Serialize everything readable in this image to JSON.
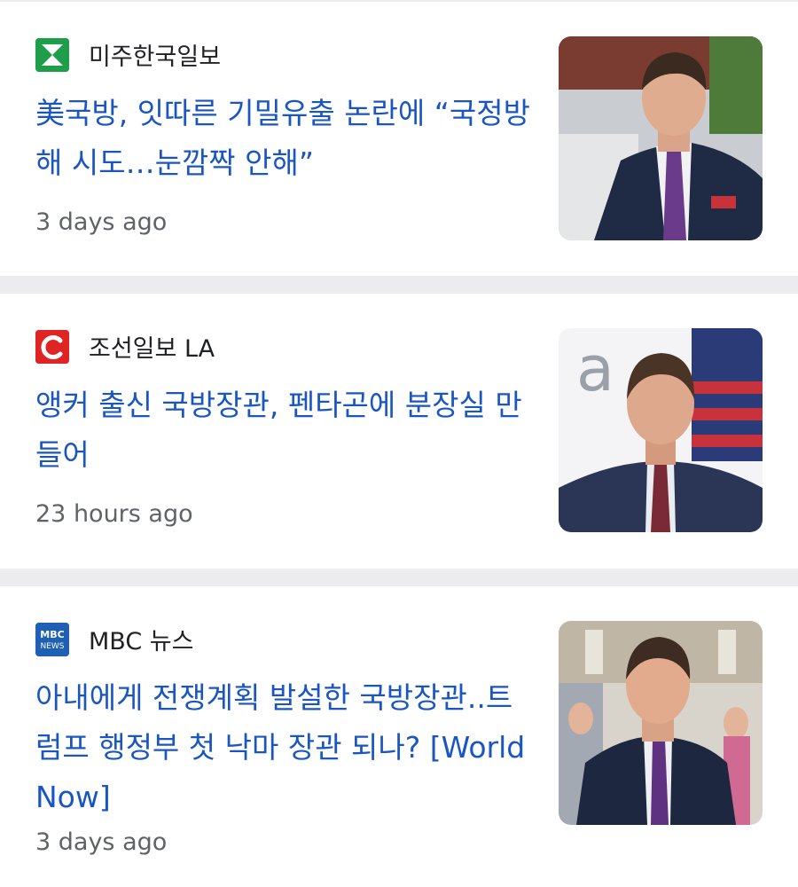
{
  "articles": [
    {
      "source": "미주한국일보",
      "source_logo": "hankook-logo",
      "headline": "美국방, 잇따른 기밀유출 논란에 “국정방해 시도…눈깜짝 안해”",
      "time": "3 days ago",
      "thumbnail": "man-in-suit-purple-tie"
    },
    {
      "source": "조선일보 LA",
      "source_logo": "chosun-logo",
      "headline": "앵커 출신 국방장관, 펜타곤에 분장실 만들어",
      "time": "23 hours ago",
      "thumbnail": "man-in-suit-flag-background"
    },
    {
      "source": "MBC 뉴스",
      "source_logo": "mbc-news-logo",
      "headline": "아내에게 전쟁계획 발설한 국방장관..트럼프 행정부 첫 낙마 장관 되나? [World Now]",
      "time": "3 days ago",
      "thumbnail": "man-in-suit-crowd-background"
    }
  ],
  "colors": {
    "headline": "#1a56c2",
    "source": "#202124",
    "time": "#5f6368",
    "separator": "#ececef"
  }
}
